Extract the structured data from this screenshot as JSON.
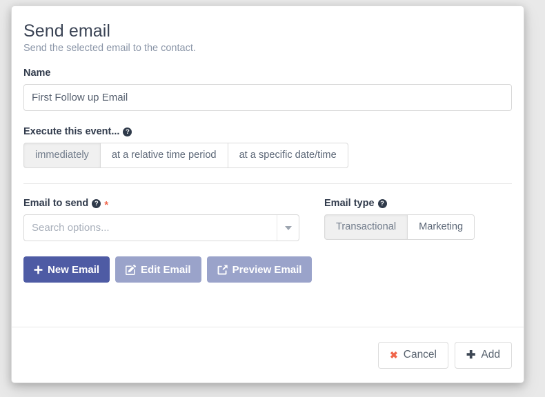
{
  "dialog": {
    "title": "Send email",
    "subtitle": "Send the selected email to the contact."
  },
  "name_field": {
    "label": "Name",
    "value": "First Follow up Email",
    "placeholder": ""
  },
  "execute_event": {
    "label": "Execute this event...",
    "help_icon": "question-circle-icon",
    "options": [
      {
        "label": "immediately",
        "active": true
      },
      {
        "label": "at a relative time period",
        "active": false
      },
      {
        "label": "at a specific date/time",
        "active": false
      }
    ]
  },
  "email_to_send": {
    "label": "Email to send",
    "help_icon": "question-circle-icon",
    "required_marker": "*",
    "placeholder": "Search options...",
    "value": "",
    "caret_icon": "chevron-down-icon"
  },
  "email_type": {
    "label": "Email type",
    "help_icon": "question-circle-icon",
    "options": [
      {
        "label": "Transactional",
        "active": true
      },
      {
        "label": "Marketing",
        "active": false
      }
    ]
  },
  "actions": [
    {
      "label": "New Email",
      "icon": "plus-icon",
      "style": "primary"
    },
    {
      "label": "Edit Email",
      "icon": "pencil-square-icon",
      "style": "muted"
    },
    {
      "label": "Preview Email",
      "icon": "external-link-icon",
      "style": "muted"
    }
  ],
  "footer": {
    "cancel_label": "Cancel",
    "cancel_icon": "x-icon",
    "add_label": "Add",
    "add_icon": "plus-icon"
  },
  "colors": {
    "primary": "#4e5ba4",
    "muted_primary": "#9aa3ca",
    "danger": "#f0654a",
    "text": "#313b4c",
    "subtitle": "#8b96a8"
  }
}
